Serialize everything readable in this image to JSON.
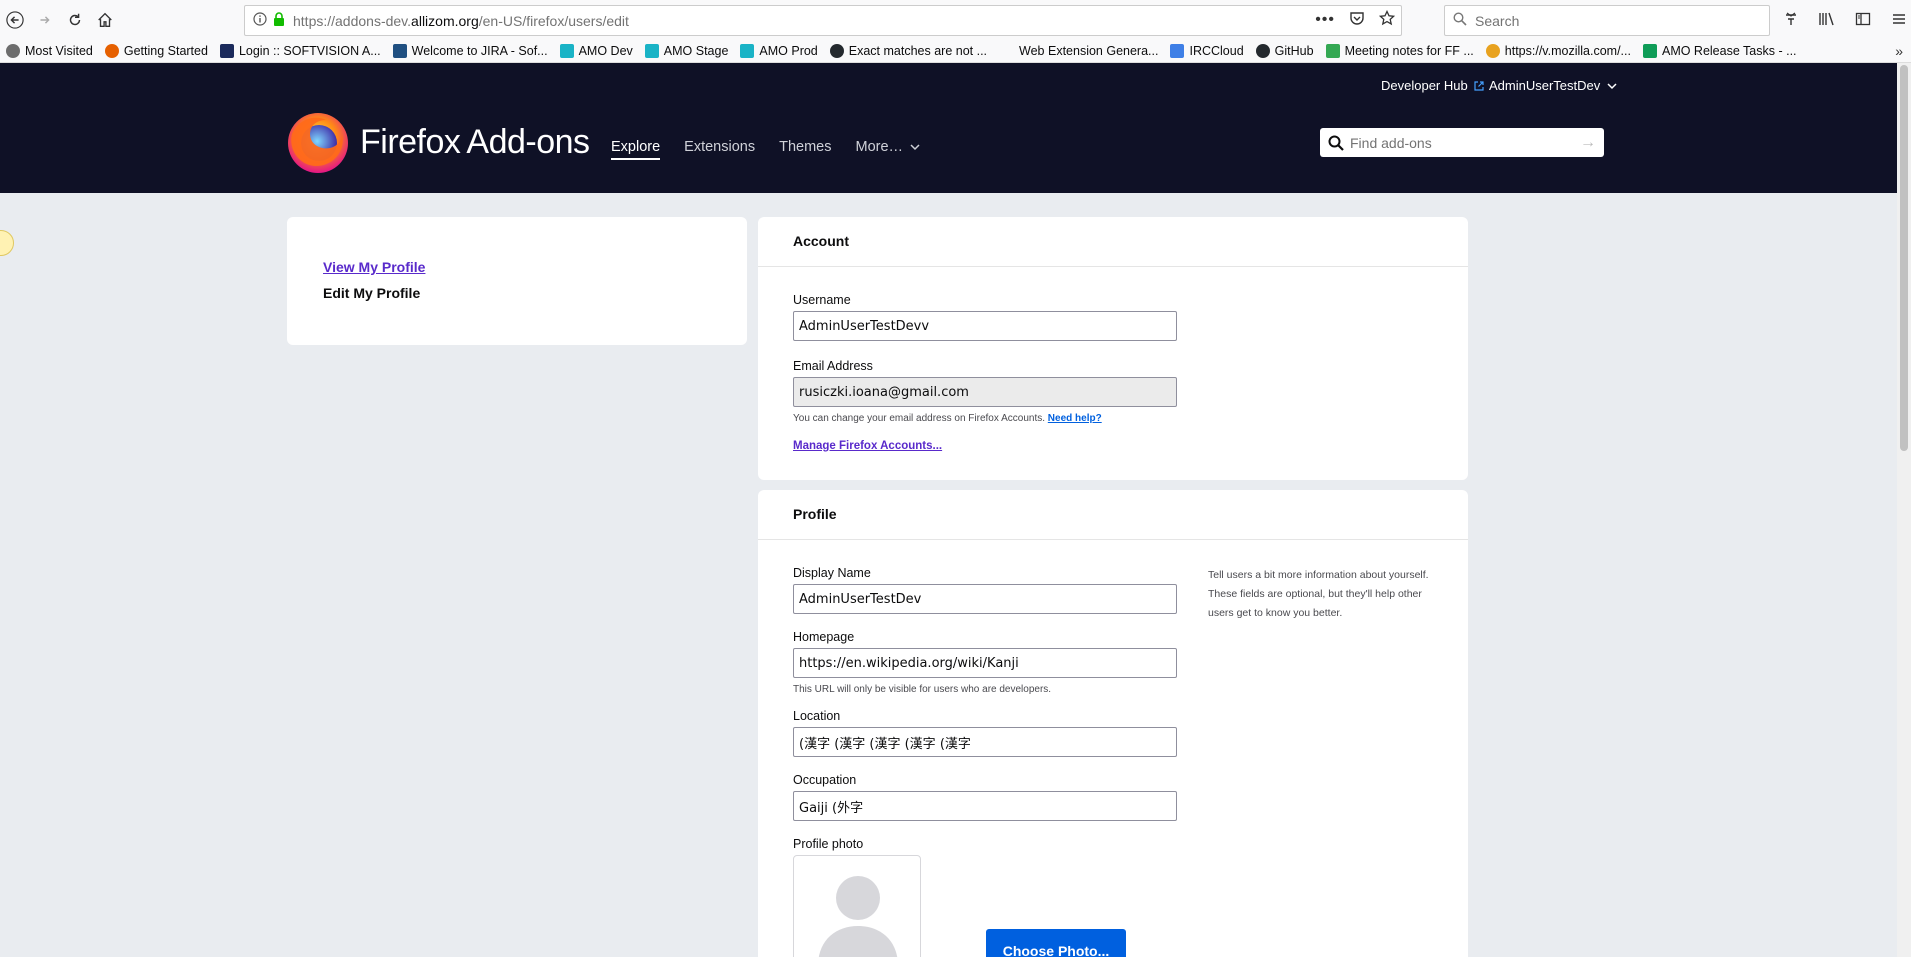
{
  "browser": {
    "url_prefix": "https://addons-dev.",
    "url_domain": "allizom.org",
    "url_suffix": "/en-US/firefox/users/edit",
    "search_placeholder": "Search",
    "bookmarks": [
      {
        "label": "Most Visited",
        "color": "#6d6d6d"
      },
      {
        "label": "Getting Started",
        "color": "#e66000"
      },
      {
        "label": "Login :: SOFTVISION A...",
        "color": "#1b2a5b"
      },
      {
        "label": "Welcome to JIRA - Sof...",
        "color": "#205081"
      },
      {
        "label": "AMO Dev",
        "color": "#1ab3c6"
      },
      {
        "label": "AMO Stage",
        "color": "#1ab3c6"
      },
      {
        "label": "AMO Prod",
        "color": "#1ab3c6"
      },
      {
        "label": "Exact matches are not ...",
        "color": "#24292e"
      },
      {
        "label": "Web Extension Genera...",
        "color": "#ffffff"
      },
      {
        "label": "IRCCloud",
        "color": "#3e7fe6"
      },
      {
        "label": "GitHub",
        "color": "#24292e"
      },
      {
        "label": "Meeting notes for FF ...",
        "color": "#34a853"
      },
      {
        "label": "https://v.mozilla.com/...",
        "color": "#e8a21f"
      },
      {
        "label": "AMO Release Tasks - ...",
        "color": "#0f9d58"
      }
    ]
  },
  "header": {
    "dev_hub": "Developer Hub",
    "user": "AdminUserTestDev",
    "brand": "Firefox",
    "brand_suffix": "Add-ons",
    "nav": [
      "Explore",
      "Extensions",
      "Themes",
      "More…"
    ],
    "search_placeholder": "Find add-ons"
  },
  "sidebar": {
    "view_profile": "View My Profile",
    "edit_profile": "Edit My Profile"
  },
  "account": {
    "title": "Account",
    "username_label": "Username",
    "username_value": "AdminUserTestDevv",
    "email_label": "Email Address",
    "email_value": "rusiczki.ioana@gmail.com",
    "email_help": "You can change your email address on Firefox Accounts.",
    "need_help": "Need help?",
    "manage_link": "Manage Firefox Accounts..."
  },
  "profile": {
    "title": "Profile",
    "aside": "Tell users a bit more information about yourself. These fields are optional, but they'll help other users get to know you better.",
    "display_name_label": "Display Name",
    "display_name_value": "AdminUserTestDev",
    "homepage_label": "Homepage",
    "homepage_value": "https://en.wikipedia.org/wiki/Kanji",
    "homepage_help": "This URL will only be visible for users who are developers.",
    "location_label": "Location",
    "location_value": "(漢字 (漢字 (漢字 (漢字 (漢字",
    "occupation_label": "Occupation",
    "occupation_value": "Gaiji (外字",
    "photo_label": "Profile photo",
    "photo_button": "Choose Photo..."
  }
}
